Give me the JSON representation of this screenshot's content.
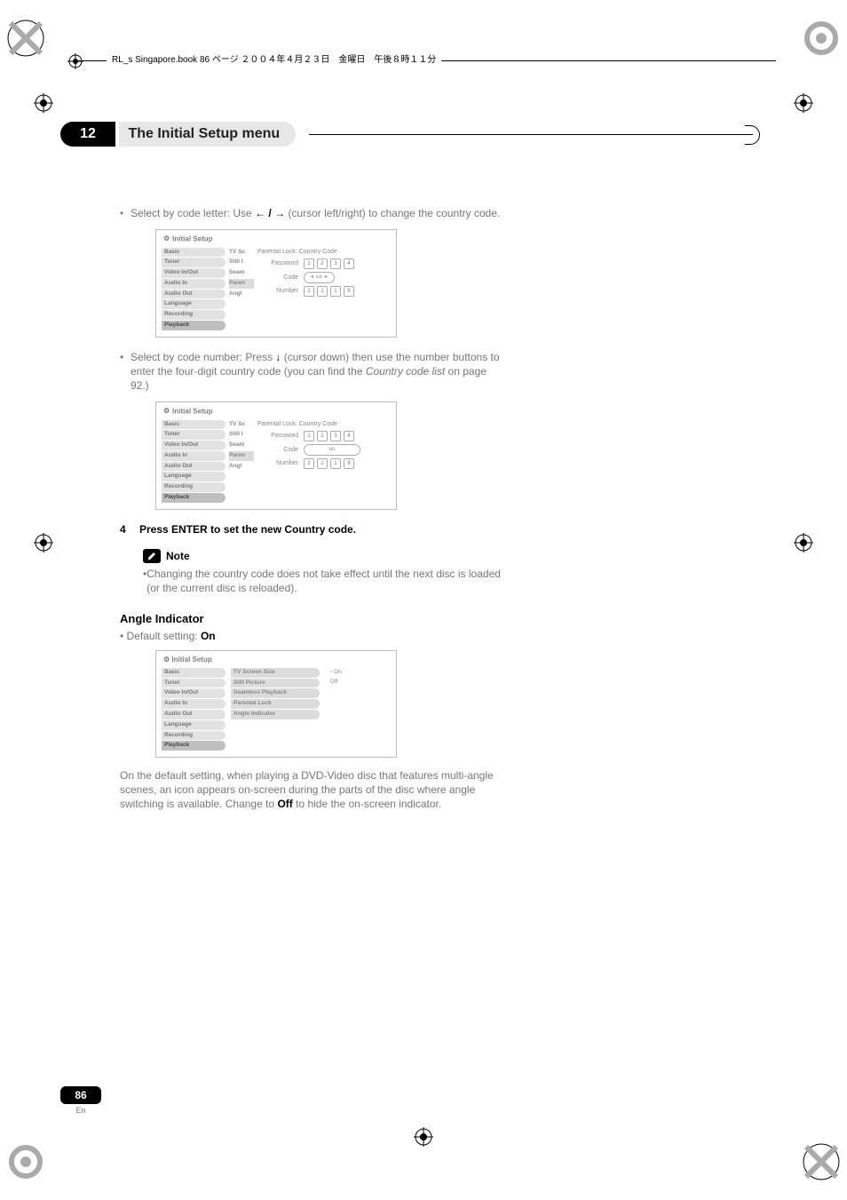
{
  "header_label": "RL_s Singapore.book  86 ページ  ２００４年４月２３日　金曜日　午後８時１１分",
  "chapter": {
    "number": "12",
    "title": "The Initial Setup menu"
  },
  "body": {
    "p1_prefix": "Select by code letter: Use ",
    "p1_arrows": "← / →",
    "p1_suffix": " (cursor left/right) to change the country code.",
    "p2_prefix": "Select by code number: Press ",
    "p2_arrow": "↓",
    "p2_mid": " (cursor down)  then use the number buttons to enter the four-digit country code (you can find the ",
    "p2_emph": "Country code list",
    "p2_suffix": " on page 92.)",
    "step4_num": "4",
    "step4_text": "Press ENTER to set the new Country code.",
    "note_label": "Note",
    "note_text": "Changing the country code does not take effect until the next disc is loaded (or the current disc is reloaded).",
    "h3": "Angle Indicator",
    "default_prefix": "Default setting: ",
    "default_value": "On",
    "end_prefix": "On the default setting, when playing a DVD-Video disc that features multi-angle scenes, an icon appears on-screen during the parts of the disc where angle switching is available. Change to ",
    "end_bold": "Off",
    "end_suffix": " to hide the on-screen indicator."
  },
  "fig_menu": {
    "title": "Initial Setup",
    "side": [
      "Basic",
      "Tuner",
      "Video In/Out",
      "Audio In",
      "Audio Out",
      "Language",
      "Recording",
      "Playback"
    ],
    "midA": [
      "TV Sc",
      "Still I",
      "Seam",
      "Paren",
      "Angl"
    ],
    "pane": {
      "title": "Parental Lock: Country Code",
      "row_password": "Password",
      "password_digits": [
        "1",
        "2",
        "3",
        "4"
      ],
      "row_code": "Code",
      "code_val": "us",
      "row_number": "Number",
      "number_digitsA": [
        "2",
        "1",
        "1",
        "9"
      ],
      "number_digitsB": [
        "2",
        "1",
        "1",
        "9"
      ]
    }
  },
  "fig_angle": {
    "title": "Initial Setup",
    "side": [
      "Basic",
      "Tuner",
      "Video In/Out",
      "Audio In",
      "Audio Out",
      "Language",
      "Recording",
      "Playback"
    ],
    "mid": [
      "TV Screen Size",
      "Still Picture",
      "Seamless Playback",
      "Parental Lock",
      "Angle Indicator"
    ],
    "opts": [
      "On",
      "Off"
    ]
  },
  "page": {
    "num": "86",
    "lang": "En"
  }
}
